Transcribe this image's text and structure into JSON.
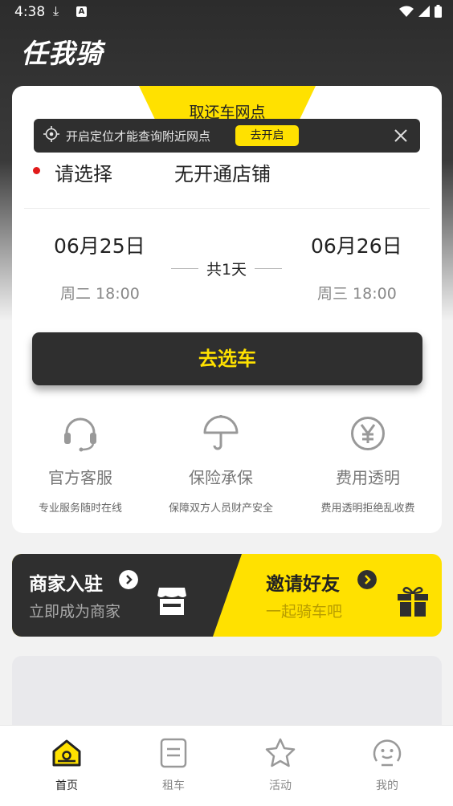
{
  "status_bar": {
    "time": "4:38",
    "download_icon": "download-icon",
    "a_icon": "A"
  },
  "app": {
    "logo": "任我骑"
  },
  "rental_card": {
    "tab_label": "取还车网点",
    "location_tip": "开启定位才能查询附近网点",
    "location_button": "去开启",
    "pick_label": "请选择",
    "store_text": "无开通店铺",
    "start_date": "06月25日",
    "start_time": "周二 18:00",
    "end_date": "06月26日",
    "end_time": "周三 18:00",
    "duration": "共1天",
    "go_button": "去选车"
  },
  "features": [
    {
      "icon": "headset-icon",
      "title": "官方客服",
      "subtitle": "专业服务随时在线"
    },
    {
      "icon": "umbrella-icon",
      "title": "保险承保",
      "subtitle": "保障双方人员财产安全"
    },
    {
      "icon": "yen-icon",
      "title": "费用透明",
      "subtitle": "费用透明拒绝乱收费"
    }
  ],
  "banners": {
    "merchant": {
      "title": "商家入驻",
      "subtitle": "立即成为商家"
    },
    "invite": {
      "title": "邀请好友",
      "subtitle": "一起骑车吧"
    }
  },
  "tabs": [
    {
      "label": "首页",
      "icon": "home-icon",
      "active": true
    },
    {
      "label": "租车",
      "icon": "document-icon",
      "active": false
    },
    {
      "label": "活动",
      "icon": "star-icon",
      "active": false
    },
    {
      "label": "我的",
      "icon": "profile-icon",
      "active": false
    }
  ],
  "colors": {
    "accent": "#ffe100",
    "dark": "#2f2f2f",
    "dot": "#e11a1a"
  }
}
